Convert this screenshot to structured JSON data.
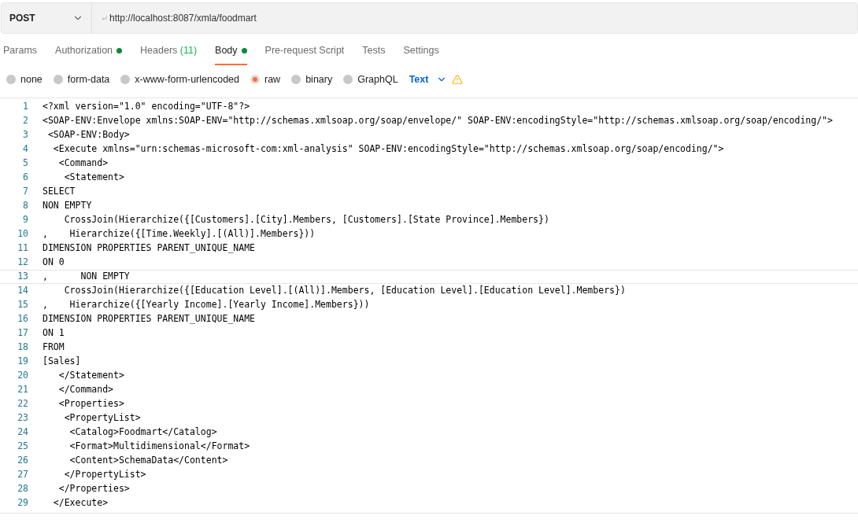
{
  "request": {
    "method": "POST",
    "url": "http://localhost:8087/xmla/foodmart"
  },
  "tabs": [
    {
      "label": "Params",
      "selected": false,
      "dot": false
    },
    {
      "label": "Authorization",
      "selected": false,
      "dot": true
    },
    {
      "label": "Headers",
      "count": "(11)",
      "selected": false,
      "dot": false
    },
    {
      "label": "Body",
      "selected": true,
      "dot": true
    },
    {
      "label": "Pre-request Script",
      "selected": false,
      "dot": false
    },
    {
      "label": "Tests",
      "selected": false,
      "dot": false
    },
    {
      "label": "Settings",
      "selected": false,
      "dot": false
    }
  ],
  "body_types": [
    {
      "label": "none",
      "selected": false
    },
    {
      "label": "form-data",
      "selected": false
    },
    {
      "label": "x-www-form-urlencoded",
      "selected": false
    },
    {
      "label": "raw",
      "selected": true
    },
    {
      "label": "binary",
      "selected": false
    },
    {
      "label": "GraphQL",
      "selected": false
    }
  ],
  "format": "Text",
  "editor": {
    "lines": [
      {
        "number": "1",
        "text": "<?xml version=\"1.0\" encoding=\"UTF-8\"?>"
      },
      {
        "number": "2",
        "text": "<SOAP-ENV:Envelope xmlns:SOAP-ENV=\"http://schemas.xmlsoap.org/soap/envelope/\" SOAP-ENV:encodingStyle=\"http://schemas.xmlsoap.org/soap/encoding/\">"
      },
      {
        "number": "3",
        "text": " <SOAP-ENV:Body>"
      },
      {
        "number": "4",
        "text": "  <Execute xmlns=\"urn:schemas-microsoft-com:xml-analysis\" SOAP-ENV:encodingStyle=\"http://schemas.xmlsoap.org/soap/encoding/\">"
      },
      {
        "number": "5",
        "text": "   <Command>"
      },
      {
        "number": "6",
        "text": "    <Statement>"
      },
      {
        "number": "7",
        "text": "SELECT "
      },
      {
        "number": "8",
        "text": "NON EMPTY "
      },
      {
        "number": "9",
        "text": "    CrossJoin(Hierarchize({[Customers].[City].Members, [Customers].[State Province].Members})"
      },
      {
        "number": "10",
        "text": ",    Hierarchize({[Time.Weekly].[(All)].Members}))"
      },
      {
        "number": "11",
        "text": "DIMENSION PROPERTIES PARENT_UNIQUE_NAME"
      },
      {
        "number": "12",
        "text": "ON 0"
      },
      {
        "number": "13",
        "text": ",      NON EMPTY ",
        "current": true
      },
      {
        "number": "14",
        "text": "    CrossJoin(Hierarchize({[Education Level].[(All)].Members, [Education Level].[Education Level].Members})"
      },
      {
        "number": "15",
        "text": ",    Hierarchize({[Yearly Income].[Yearly Income].Members}))"
      },
      {
        "number": "16",
        "text": "DIMENSION PROPERTIES PARENT_UNIQUE_NAME"
      },
      {
        "number": "17",
        "text": "ON 1"
      },
      {
        "number": "18",
        "text": "FROM"
      },
      {
        "number": "19",
        "text": "[Sales]"
      },
      {
        "number": "20",
        "text": "   </Statement>"
      },
      {
        "number": "21",
        "text": "   </Command>"
      },
      {
        "number": "22",
        "text": "   <Properties>"
      },
      {
        "number": "23",
        "text": "    <PropertyList>      "
      },
      {
        "number": "24",
        "text": "     <Catalog>Foodmart</Catalog>"
      },
      {
        "number": "25",
        "text": "     <Format>Multidimensional</Format>"
      },
      {
        "number": "26",
        "text": "     <Content>SchemaData</Content>"
      },
      {
        "number": "27",
        "text": "    </PropertyList>"
      },
      {
        "number": "28",
        "text": "   </Properties>"
      },
      {
        "number": "29",
        "text": "  </Execute>"
      }
    ]
  }
}
